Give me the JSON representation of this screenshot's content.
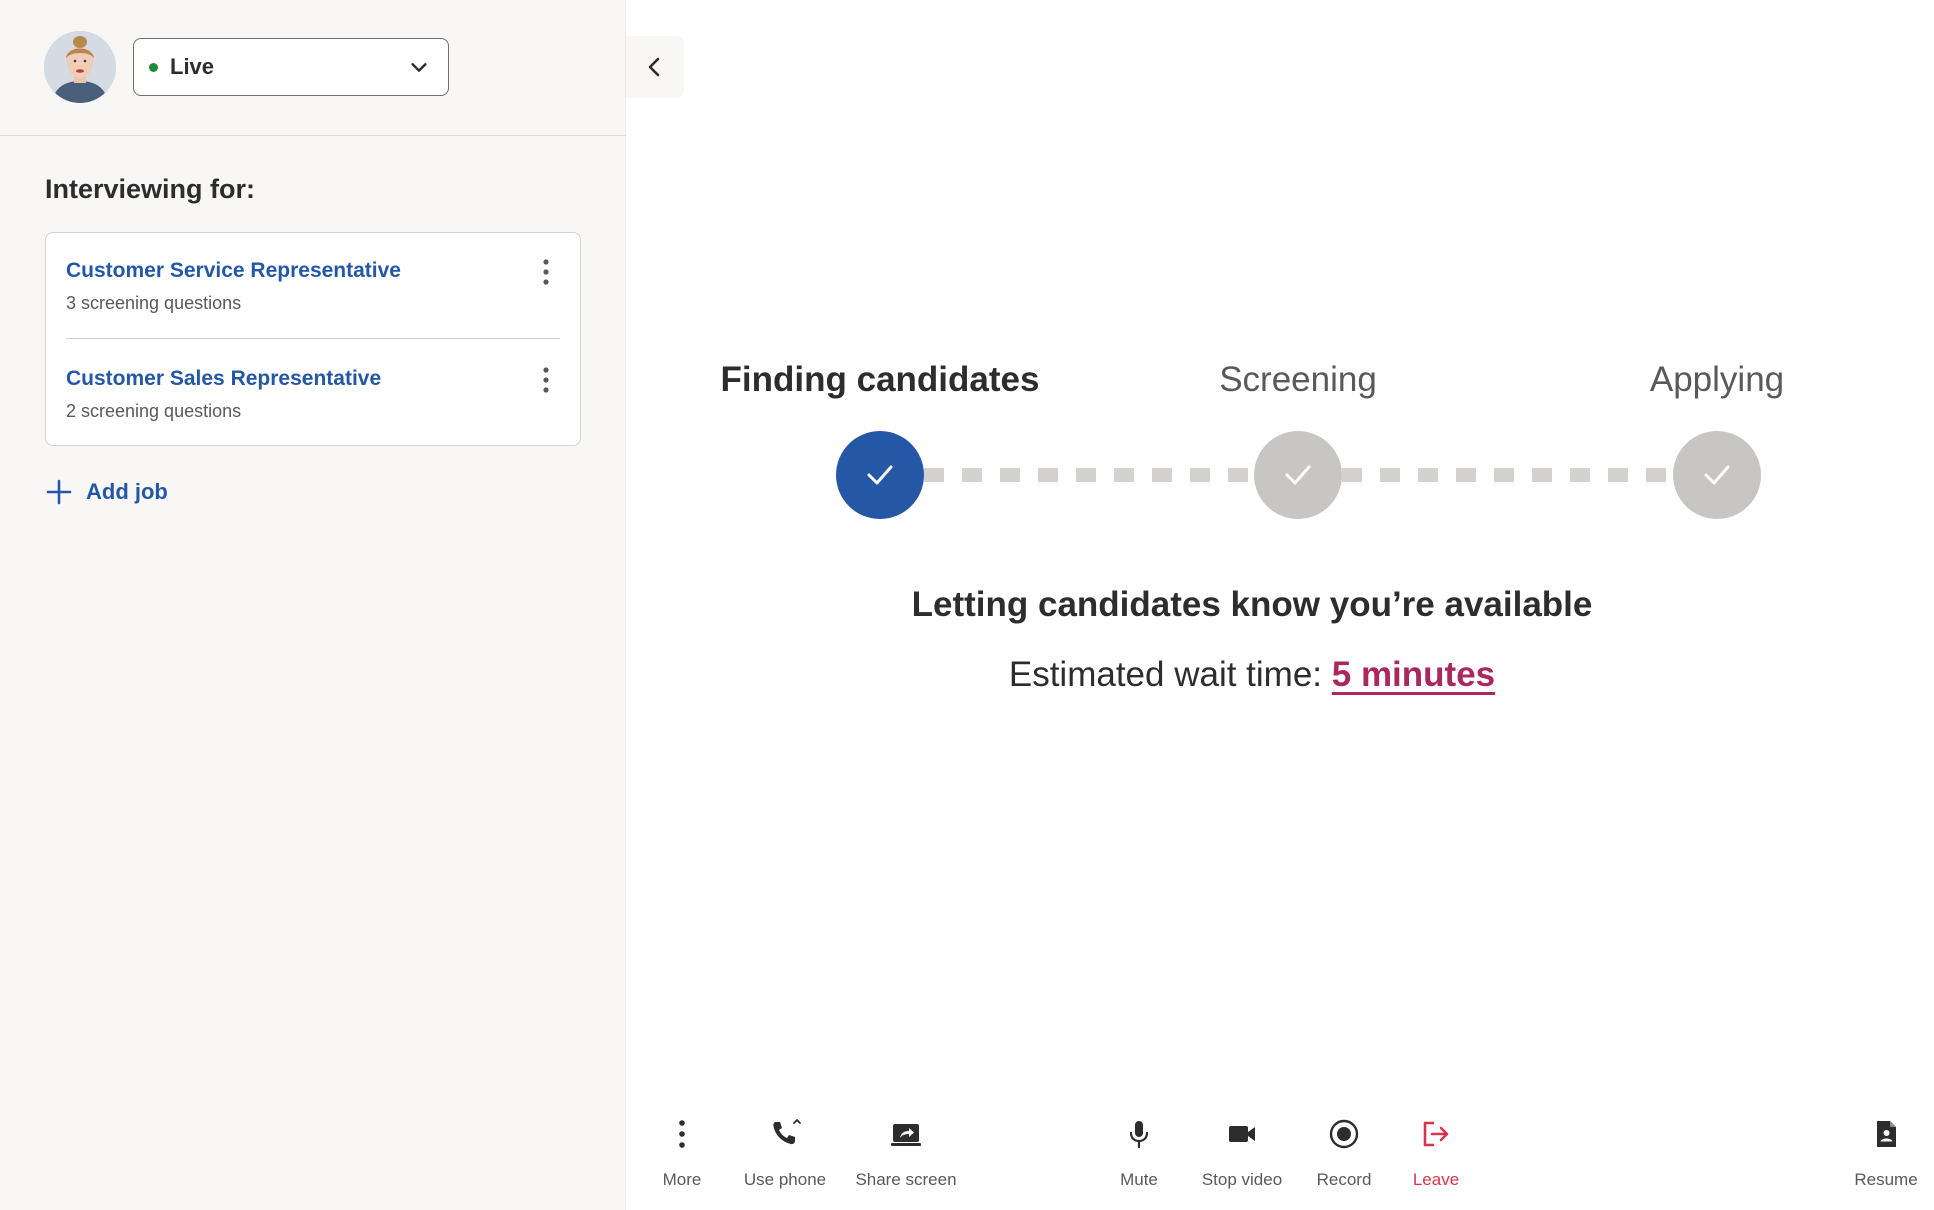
{
  "sidebar": {
    "status": {
      "label": "Live",
      "color": "#1f8a3a"
    },
    "section_title": "Interviewing for:",
    "jobs": [
      {
        "title": "Customer Service Representative",
        "subtitle": "3 screening questions"
      },
      {
        "title": "Customer Sales Representative",
        "subtitle": "2 screening questions"
      }
    ],
    "add_job_label": "Add job"
  },
  "progress": {
    "steps": [
      {
        "label": "Finding candidates",
        "state": "active"
      },
      {
        "label": "Screening",
        "state": "pending"
      },
      {
        "label": "Applying",
        "state": "pending"
      }
    ],
    "active_color": "#2557a7",
    "pending_color": "#c8c6c4"
  },
  "status": {
    "heading": "Letting candidates know you’re available",
    "wait_label": "Estimated wait time: ",
    "wait_value": "5 minutes",
    "wait_color": "#a9295e"
  },
  "toolbar": {
    "more": "More",
    "use_phone": "Use phone",
    "share_screen": "Share screen",
    "mute": "Mute",
    "stop_video": "Stop video",
    "record": "Record",
    "leave": "Leave",
    "resume": "Resume",
    "leave_color": "#d9354a"
  },
  "icons": [
    "chevron-down-icon",
    "chevron-left-icon",
    "kebab-icon",
    "plus-icon",
    "check-icon",
    "phone-icon",
    "share-screen-icon",
    "microphone-icon",
    "video-camera-icon",
    "record-icon",
    "leave-icon",
    "document-icon"
  ]
}
